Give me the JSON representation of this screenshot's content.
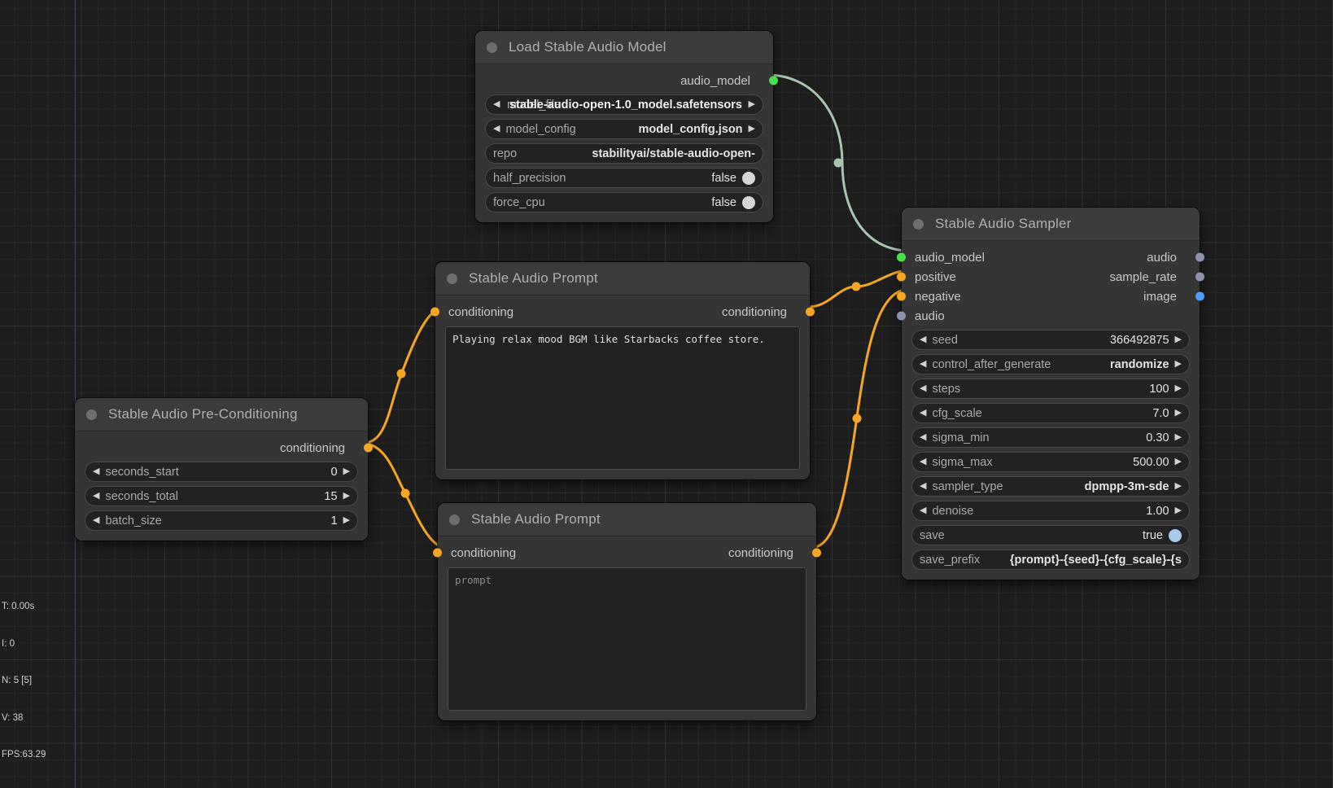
{
  "app": {
    "background": "#1d1d1d",
    "accent_orange": "#f5a623",
    "accent_green": "#6fe06f",
    "accent_blue": "#4a9eff"
  },
  "nodes": {
    "load_model": {
      "title": "Load Stable Audio Model",
      "outputs": [
        {
          "label": "audio_model",
          "color": "#4ae04a"
        }
      ],
      "widgets": [
        {
          "label": "model_file",
          "value": "stable-audio-open-1.0_model.safetensors",
          "type": "combo",
          "overlap": true
        },
        {
          "label": "model_config",
          "value": "model_config.json",
          "type": "combo"
        },
        {
          "label": "repo",
          "value": "stabilityai/stable-audio-open-",
          "type": "text"
        },
        {
          "label": "half_precision",
          "value": "false",
          "type": "toggle"
        },
        {
          "label": "force_cpu",
          "value": "false",
          "type": "toggle"
        }
      ]
    },
    "pre_conditioning": {
      "title": "Stable Audio Pre-Conditioning",
      "outputs": [
        {
          "label": "conditioning",
          "color": "#f5a623"
        }
      ],
      "widgets": [
        {
          "label": "seconds_start",
          "value": "0",
          "type": "number"
        },
        {
          "label": "seconds_total",
          "value": "15",
          "type": "number"
        },
        {
          "label": "batch_size",
          "value": "1",
          "type": "number"
        }
      ]
    },
    "prompt_positive": {
      "title": "Stable Audio Prompt",
      "inputs": [
        {
          "label": "conditioning",
          "color": "#f5a623"
        }
      ],
      "outputs": [
        {
          "label": "conditioning",
          "color": "#f5a623"
        }
      ],
      "text": "Playing relax mood BGM like Starbacks coffee store.",
      "is_placeholder": false
    },
    "prompt_negative": {
      "title": "Stable Audio Prompt",
      "inputs": [
        {
          "label": "conditioning",
          "color": "#f5a623"
        }
      ],
      "outputs": [
        {
          "label": "conditioning",
          "color": "#f5a623"
        }
      ],
      "text": "prompt",
      "is_placeholder": true
    },
    "sampler": {
      "title": "Stable Audio Sampler",
      "inputs": [
        {
          "label": "audio_model",
          "color": "#4ae04a"
        },
        {
          "label": "positive",
          "color": "#f5a623"
        },
        {
          "label": "negative",
          "color": "#f5a623"
        },
        {
          "label": "audio",
          "color": "#8f8fb0"
        }
      ],
      "outputs": [
        {
          "label": "audio",
          "color": "#8f8fb0"
        },
        {
          "label": "sample_rate",
          "color": "#8f8fb0"
        },
        {
          "label": "image",
          "color": "#4a9eff"
        }
      ],
      "widgets": [
        {
          "label": "seed",
          "value": "366492875",
          "type": "number"
        },
        {
          "label": "control_after_generate",
          "value": "randomize",
          "type": "combo"
        },
        {
          "label": "steps",
          "value": "100",
          "type": "number"
        },
        {
          "label": "cfg_scale",
          "value": "7.0",
          "type": "number"
        },
        {
          "label": "sigma_min",
          "value": "0.30",
          "type": "number"
        },
        {
          "label": "sigma_max",
          "value": "500.00",
          "type": "number"
        },
        {
          "label": "sampler_type",
          "value": "dpmpp-3m-sde",
          "type": "combo"
        },
        {
          "label": "denoise",
          "value": "1.00",
          "type": "number"
        },
        {
          "label": "save",
          "value": "true",
          "type": "boolean-toggle"
        },
        {
          "label": "save_prefix",
          "value": "{prompt}-{seed}-{cfg_scale}-{s",
          "type": "text"
        }
      ]
    }
  },
  "stats": {
    "time": "T: 0.00s",
    "iterations": "I: 0",
    "nodes": "N: 5 [5]",
    "vertices": "V: 38",
    "fps": "FPS:63.29"
  }
}
